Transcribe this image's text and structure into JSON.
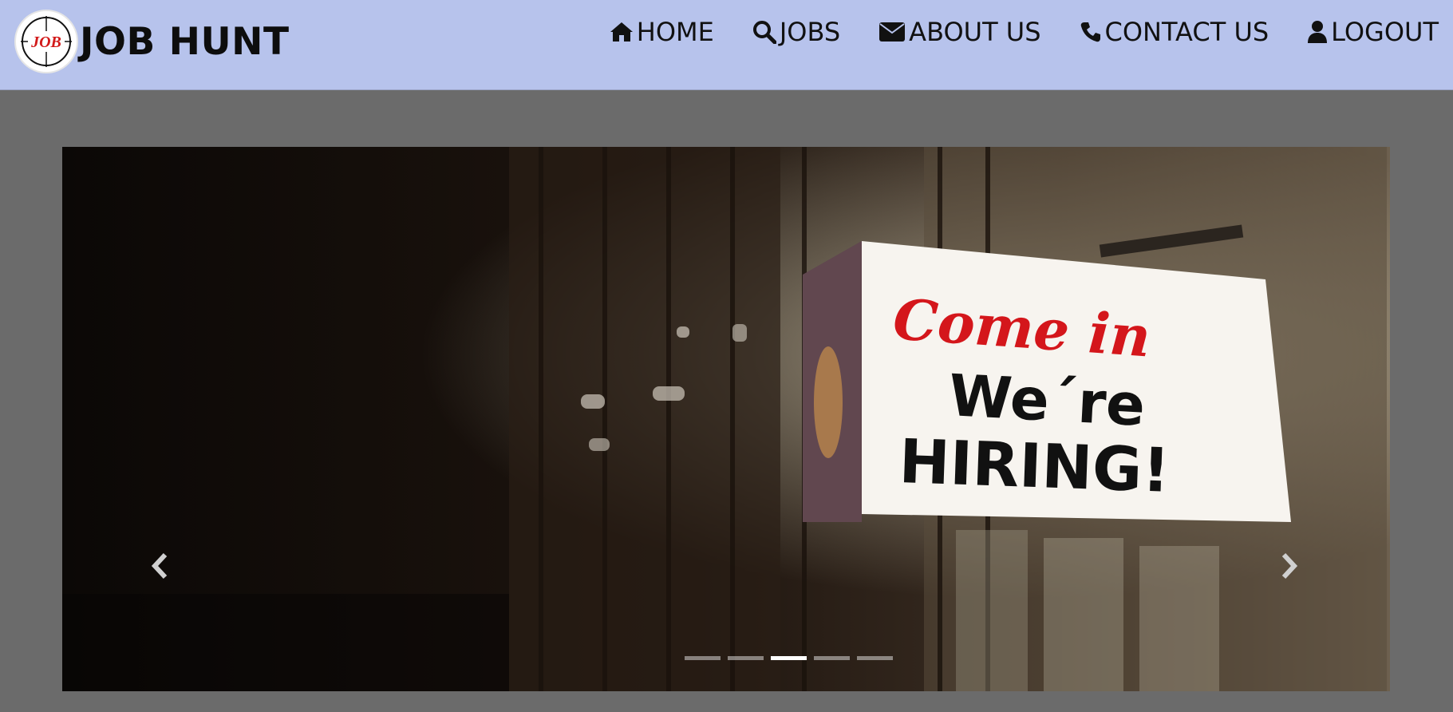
{
  "brand": {
    "logo_text": "JOB",
    "title": "JOB HUNT",
    "logo_color": "#d21a1a"
  },
  "nav": {
    "items": [
      {
        "label": "HOME",
        "icon": "home-icon"
      },
      {
        "label": "JOBS",
        "icon": "search-icon"
      },
      {
        "label": "ABOUT US",
        "icon": "envelope-icon"
      },
      {
        "label": "CONTACT US",
        "icon": "phone-icon"
      },
      {
        "label": "LOGOUT",
        "icon": "user-icon"
      }
    ],
    "background": "#b7c3ec"
  },
  "carousel": {
    "slide_sign": {
      "line1": "Come in",
      "line2": "We´re",
      "line3": "HIRING!"
    },
    "indicator_count": 5,
    "active_index": 2,
    "prev_icon": "chevron-left-icon",
    "next_icon": "chevron-right-icon"
  },
  "colors": {
    "page_bg": "#6b6b6b",
    "sign_red": "#d4161b"
  }
}
